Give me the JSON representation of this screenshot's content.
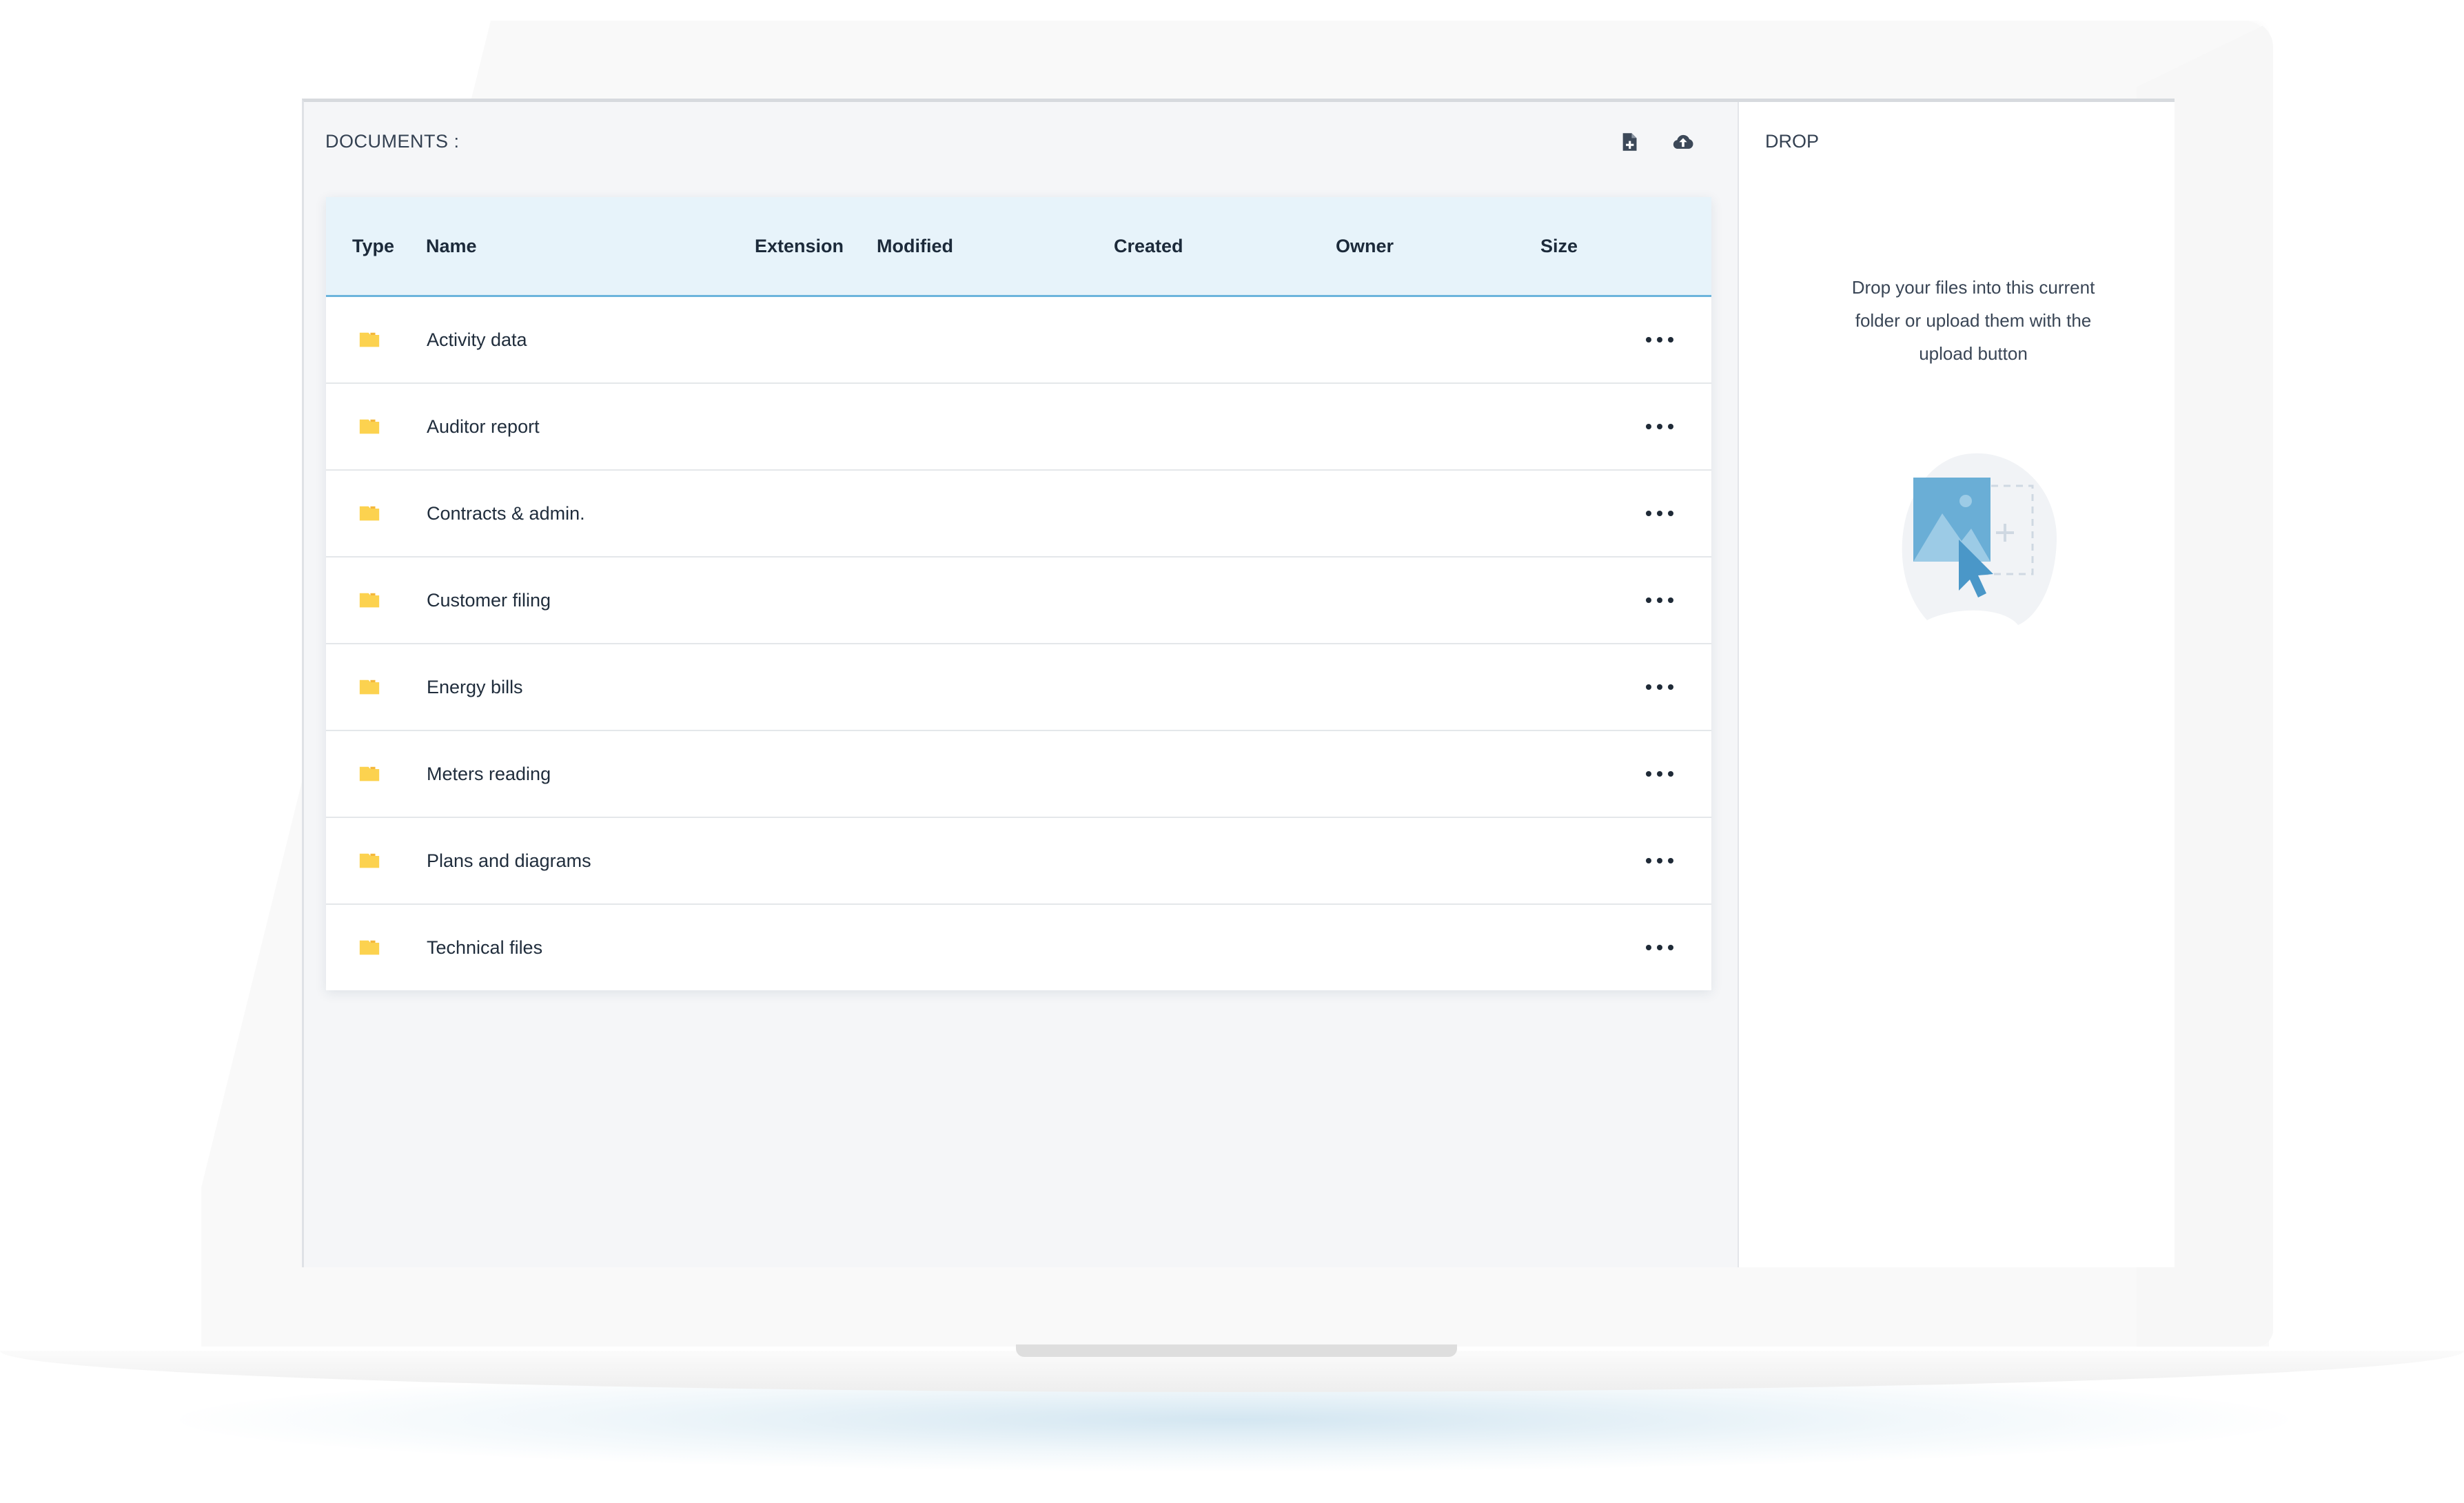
{
  "documents": {
    "title": "DOCUMENTS :",
    "toolbar": {
      "new_folder_icon": "folder-plus-icon",
      "upload_icon": "cloud-upload-icon"
    },
    "columns": [
      "Type",
      "Name",
      "Extension",
      "Modified",
      "Created",
      "Owner",
      "Size"
    ],
    "rows": [
      {
        "name": "Activity data"
      },
      {
        "name": "Auditor report"
      },
      {
        "name": "Contracts & admin."
      },
      {
        "name": "Customer filing"
      },
      {
        "name": "Energy bills"
      },
      {
        "name": "Meters reading"
      },
      {
        "name": "Plans and diagrams"
      },
      {
        "name": "Technical files"
      }
    ]
  },
  "drop": {
    "title": "DROP",
    "instructions": "Drop your files into this current folder or upload them with the upload button"
  },
  "colors": {
    "accent": "#6cb4dc",
    "header_bg": "#e7f3fa",
    "folder": "#fcd24f",
    "panel_bg": "#f5f6f8"
  }
}
